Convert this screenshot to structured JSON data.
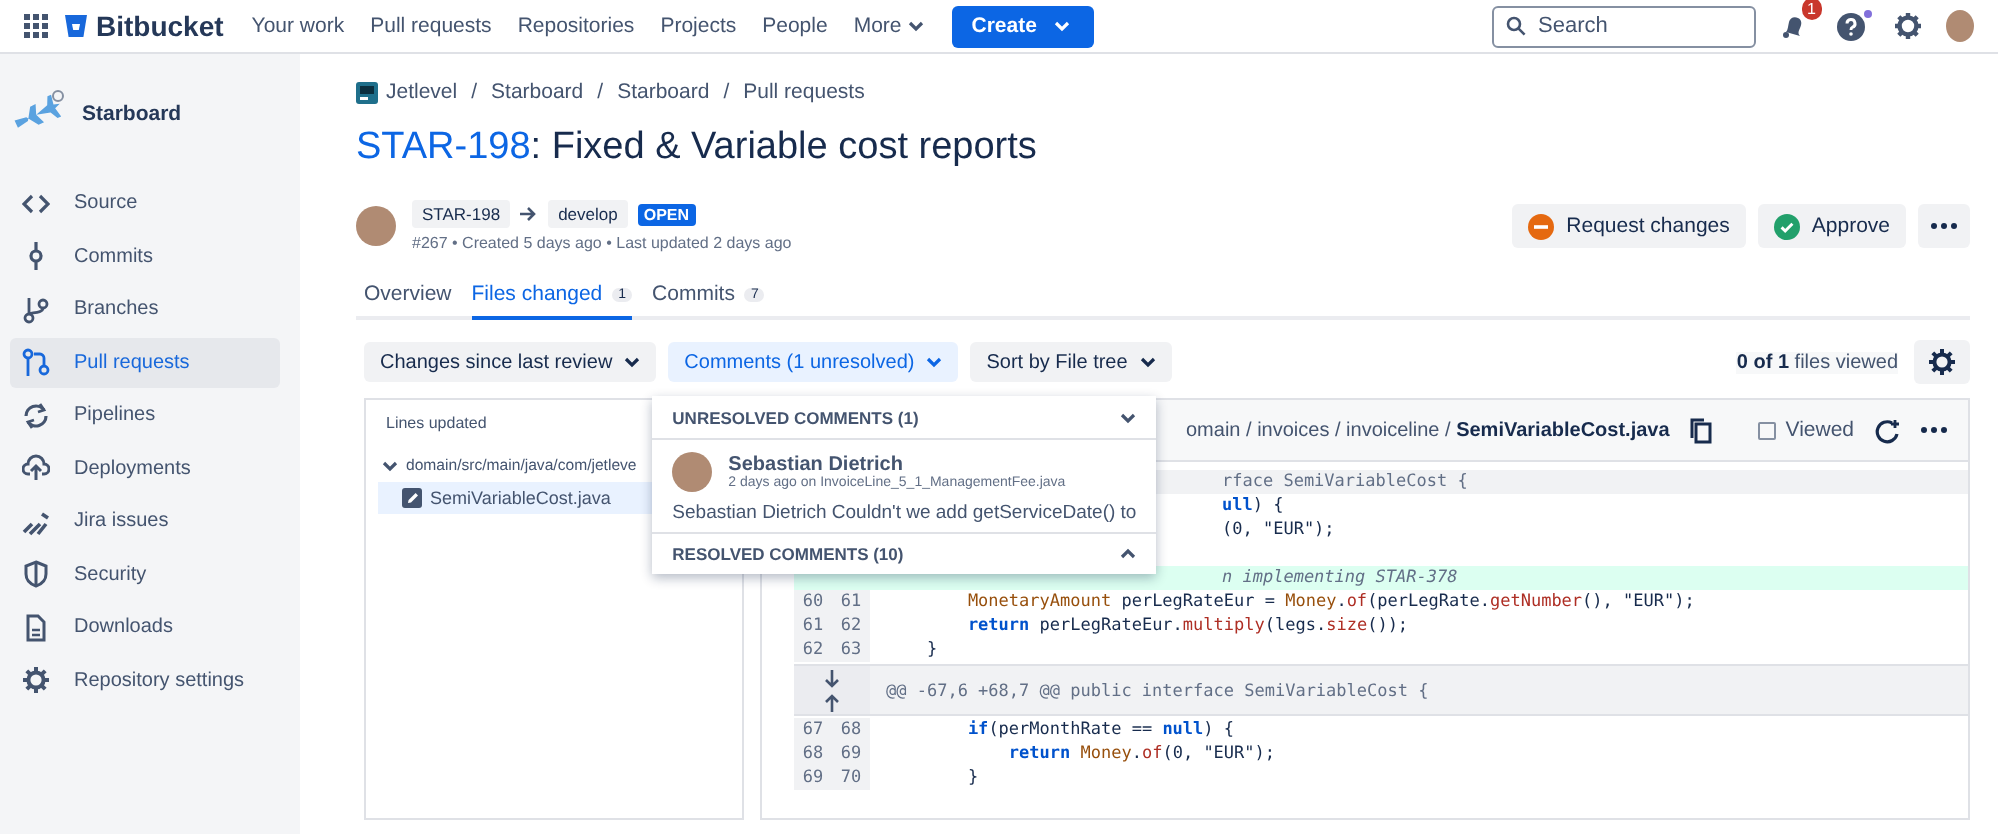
{
  "top_nav": {
    "product": "Bitbucket",
    "items": [
      "Your work",
      "Pull requests",
      "Repositories",
      "Projects",
      "People"
    ],
    "more": "More",
    "create": "Create",
    "search": {
      "placeholder": "Search"
    },
    "notification_count": "1",
    "help_has_news": true
  },
  "sidebar": {
    "repo": "Starboard",
    "items": [
      {
        "label": "Source",
        "selected": false
      },
      {
        "label": "Commits",
        "selected": false
      },
      {
        "label": "Branches",
        "selected": false
      },
      {
        "label": "Pull requests",
        "selected": true
      },
      {
        "label": "Pipelines",
        "selected": false
      },
      {
        "label": "Deployments",
        "selected": false
      },
      {
        "label": "Jira issues",
        "selected": false
      },
      {
        "label": "Security",
        "selected": false
      },
      {
        "label": "Downloads",
        "selected": false
      },
      {
        "label": "Repository settings",
        "selected": false
      }
    ]
  },
  "breadcrumbs": [
    {
      "label": "Jetlevel"
    },
    {
      "separator": "/",
      "label": "Starboard"
    },
    {
      "separator": "/",
      "label": "Starboard"
    },
    {
      "separator": "/",
      "label": "Pull requests"
    }
  ],
  "pull_request": {
    "key": "STAR-198",
    "title": ": Fixed & Variable cost reports",
    "source_branch": "STAR-198",
    "target_branch": "develop",
    "status": "OPEN",
    "meta": "#267 • Created 5 days ago • Last updated 2 days ago"
  },
  "actions": [
    {
      "label": "Request changes",
      "kind": "request"
    },
    {
      "label": "Approve",
      "kind": "approve"
    }
  ],
  "tabs": [
    {
      "label": "Overview",
      "selected": false
    },
    {
      "label": "Files changed",
      "count": "1",
      "selected": true
    },
    {
      "label": "Commits",
      "count": "7",
      "selected": false
    }
  ],
  "filters": [
    {
      "label": "Changes since last review",
      "selected": false
    },
    {
      "label": "Comments (1 unresolved)",
      "selected": true
    },
    {
      "label": "Sort by File tree",
      "selected": false
    }
  ],
  "files_viewed": "**0 of 1** files viewed",
  "comments_menu": {
    "sections": [
      {
        "title": "UNRESOLVED COMMENTS (1)",
        "expanded": true,
        "comments": [
          {
            "author": "Sebastian Dietrich",
            "meta": "2 days ago on InvoiceLine_5_1_ManagementFee.java",
            "text": "Sebastian Dietrich Couldn't we add getServiceDate() to"
          }
        ]
      },
      {
        "title": "RESOLVED COMMENTS (10)",
        "expanded": false
      }
    ]
  },
  "file_tree": {
    "heading": "Lines updated",
    "folder": {
      "label": "domain/src/main/java/com/jetleve",
      "expanded": true,
      "files": [
        {
          "label": "SemiVariableCost.java",
          "selected": true
        }
      ]
    }
  },
  "diff": {
    "path": "omain / invoices / invoiceline / **SemiVariableCost.java**",
    "viewed_label": "Viewed",
    "viewed": false,
    "lines": [
      {
        "kind": "hunk",
        "segments": [
          {
            "text": "rface SemiVariableCost {",
            "kind": "plain"
          }
        ]
      },
      {
        "kind": "context",
        "segments": [
          {
            "text": "ull",
            "kind": "kw"
          },
          {
            "text": ") {",
            "kind": "plain"
          }
        ]
      },
      {
        "kind": "context",
        "segments": [
          {
            "text": "(0, \"EUR\");",
            "kind": "plain"
          }
        ]
      },
      {
        "kind": "context"
      },
      {
        "kind": "added",
        "segments": [
          {
            "text": "n implementing STAR-378",
            "kind": "cm"
          }
        ]
      },
      {
        "kind": "context",
        "old": "60",
        "new": "61",
        "segments": [
          {
            "text": "        MonetaryAmount",
            "kind": "type"
          },
          {
            "text": " perLegRateEur = ",
            "kind": "plain"
          },
          {
            "text": "Money",
            "kind": "type"
          },
          {
            "text": ".",
            "kind": "plain"
          },
          {
            "text": "of",
            "kind": "fn"
          },
          {
            "text": "(perLegRate.",
            "kind": "plain"
          },
          {
            "text": "getNumber",
            "kind": "fn"
          },
          {
            "text": "(), \"EUR\");",
            "kind": "plain"
          }
        ]
      },
      {
        "kind": "context",
        "old": "61",
        "new": "62",
        "segments": [
          {
            "text": "        return",
            "kind": "kw"
          },
          {
            "text": " perLegRateEur.",
            "kind": "plain"
          },
          {
            "text": "multiply",
            "kind": "fn"
          },
          {
            "text": "(legs.",
            "kind": "plain"
          },
          {
            "text": "size",
            "kind": "fn"
          },
          {
            "text": "());",
            "kind": "plain"
          }
        ]
      },
      {
        "kind": "context",
        "old": "62",
        "new": "63",
        "segments": [
          {
            "text": "    }",
            "kind": "plain"
          }
        ]
      },
      {
        "kind": "expander",
        "segments": [
          {
            "text": "@@ -67,6 +68,7 @@ public interface SemiVariableCost {",
            "kind": "plain"
          }
        ]
      },
      {
        "kind": "context",
        "old": "67",
        "new": "68",
        "segments": [
          {
            "text": "        if",
            "kind": "kw"
          },
          {
            "text": "(perMonthRate == ",
            "kind": "plain"
          },
          {
            "text": "null",
            "kind": "kw"
          },
          {
            "text": ") {",
            "kind": "plain"
          }
        ]
      },
      {
        "kind": "context",
        "old": "68",
        "new": "69",
        "segments": [
          {
            "text": "            return",
            "kind": "kw"
          },
          {
            "text": " Money",
            "kind": "type"
          },
          {
            "text": ".",
            "kind": "plain"
          },
          {
            "text": "of",
            "kind": "fn"
          },
          {
            "text": "(0, \"EUR\");",
            "kind": "plain"
          }
        ]
      },
      {
        "kind": "context",
        "old": "69",
        "new": "70",
        "segments": [
          {
            "text": "        }",
            "kind": "plain"
          }
        ]
      }
    ]
  }
}
